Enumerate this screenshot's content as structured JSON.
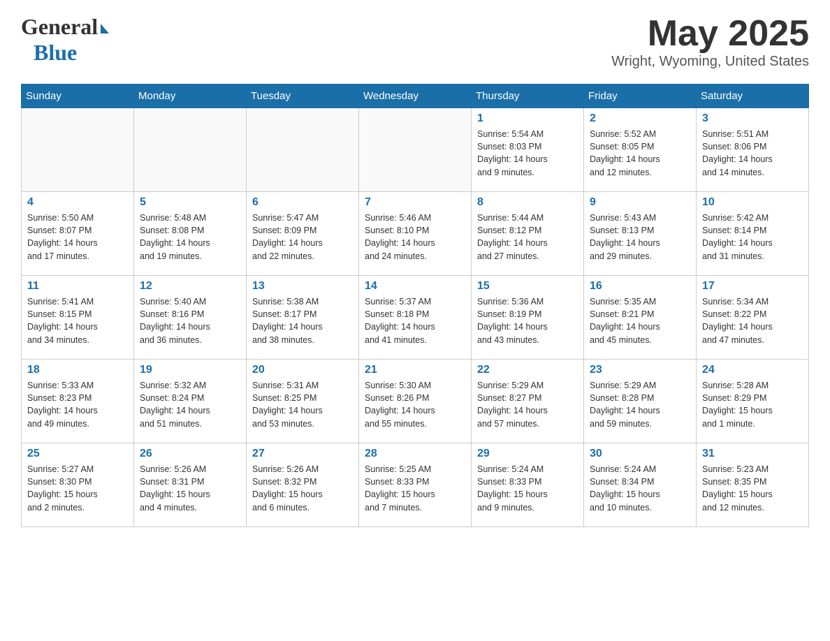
{
  "header": {
    "logo_general": "General",
    "logo_blue": "Blue",
    "month_year": "May 2025",
    "location": "Wright, Wyoming, United States"
  },
  "columns": [
    "Sunday",
    "Monday",
    "Tuesday",
    "Wednesday",
    "Thursday",
    "Friday",
    "Saturday"
  ],
  "weeks": [
    {
      "days": [
        {
          "date": "",
          "info": ""
        },
        {
          "date": "",
          "info": ""
        },
        {
          "date": "",
          "info": ""
        },
        {
          "date": "",
          "info": ""
        },
        {
          "date": "1",
          "info": "Sunrise: 5:54 AM\nSunset: 8:03 PM\nDaylight: 14 hours\nand 9 minutes."
        },
        {
          "date": "2",
          "info": "Sunrise: 5:52 AM\nSunset: 8:05 PM\nDaylight: 14 hours\nand 12 minutes."
        },
        {
          "date": "3",
          "info": "Sunrise: 5:51 AM\nSunset: 8:06 PM\nDaylight: 14 hours\nand 14 minutes."
        }
      ]
    },
    {
      "days": [
        {
          "date": "4",
          "info": "Sunrise: 5:50 AM\nSunset: 8:07 PM\nDaylight: 14 hours\nand 17 minutes."
        },
        {
          "date": "5",
          "info": "Sunrise: 5:48 AM\nSunset: 8:08 PM\nDaylight: 14 hours\nand 19 minutes."
        },
        {
          "date": "6",
          "info": "Sunrise: 5:47 AM\nSunset: 8:09 PM\nDaylight: 14 hours\nand 22 minutes."
        },
        {
          "date": "7",
          "info": "Sunrise: 5:46 AM\nSunset: 8:10 PM\nDaylight: 14 hours\nand 24 minutes."
        },
        {
          "date": "8",
          "info": "Sunrise: 5:44 AM\nSunset: 8:12 PM\nDaylight: 14 hours\nand 27 minutes."
        },
        {
          "date": "9",
          "info": "Sunrise: 5:43 AM\nSunset: 8:13 PM\nDaylight: 14 hours\nand 29 minutes."
        },
        {
          "date": "10",
          "info": "Sunrise: 5:42 AM\nSunset: 8:14 PM\nDaylight: 14 hours\nand 31 minutes."
        }
      ]
    },
    {
      "days": [
        {
          "date": "11",
          "info": "Sunrise: 5:41 AM\nSunset: 8:15 PM\nDaylight: 14 hours\nand 34 minutes."
        },
        {
          "date": "12",
          "info": "Sunrise: 5:40 AM\nSunset: 8:16 PM\nDaylight: 14 hours\nand 36 minutes."
        },
        {
          "date": "13",
          "info": "Sunrise: 5:38 AM\nSunset: 8:17 PM\nDaylight: 14 hours\nand 38 minutes."
        },
        {
          "date": "14",
          "info": "Sunrise: 5:37 AM\nSunset: 8:18 PM\nDaylight: 14 hours\nand 41 minutes."
        },
        {
          "date": "15",
          "info": "Sunrise: 5:36 AM\nSunset: 8:19 PM\nDaylight: 14 hours\nand 43 minutes."
        },
        {
          "date": "16",
          "info": "Sunrise: 5:35 AM\nSunset: 8:21 PM\nDaylight: 14 hours\nand 45 minutes."
        },
        {
          "date": "17",
          "info": "Sunrise: 5:34 AM\nSunset: 8:22 PM\nDaylight: 14 hours\nand 47 minutes."
        }
      ]
    },
    {
      "days": [
        {
          "date": "18",
          "info": "Sunrise: 5:33 AM\nSunset: 8:23 PM\nDaylight: 14 hours\nand 49 minutes."
        },
        {
          "date": "19",
          "info": "Sunrise: 5:32 AM\nSunset: 8:24 PM\nDaylight: 14 hours\nand 51 minutes."
        },
        {
          "date": "20",
          "info": "Sunrise: 5:31 AM\nSunset: 8:25 PM\nDaylight: 14 hours\nand 53 minutes."
        },
        {
          "date": "21",
          "info": "Sunrise: 5:30 AM\nSunset: 8:26 PM\nDaylight: 14 hours\nand 55 minutes."
        },
        {
          "date": "22",
          "info": "Sunrise: 5:29 AM\nSunset: 8:27 PM\nDaylight: 14 hours\nand 57 minutes."
        },
        {
          "date": "23",
          "info": "Sunrise: 5:29 AM\nSunset: 8:28 PM\nDaylight: 14 hours\nand 59 minutes."
        },
        {
          "date": "24",
          "info": "Sunrise: 5:28 AM\nSunset: 8:29 PM\nDaylight: 15 hours\nand 1 minute."
        }
      ]
    },
    {
      "days": [
        {
          "date": "25",
          "info": "Sunrise: 5:27 AM\nSunset: 8:30 PM\nDaylight: 15 hours\nand 2 minutes."
        },
        {
          "date": "26",
          "info": "Sunrise: 5:26 AM\nSunset: 8:31 PM\nDaylight: 15 hours\nand 4 minutes."
        },
        {
          "date": "27",
          "info": "Sunrise: 5:26 AM\nSunset: 8:32 PM\nDaylight: 15 hours\nand 6 minutes."
        },
        {
          "date": "28",
          "info": "Sunrise: 5:25 AM\nSunset: 8:33 PM\nDaylight: 15 hours\nand 7 minutes."
        },
        {
          "date": "29",
          "info": "Sunrise: 5:24 AM\nSunset: 8:33 PM\nDaylight: 15 hours\nand 9 minutes."
        },
        {
          "date": "30",
          "info": "Sunrise: 5:24 AM\nSunset: 8:34 PM\nDaylight: 15 hours\nand 10 minutes."
        },
        {
          "date": "31",
          "info": "Sunrise: 5:23 AM\nSunset: 8:35 PM\nDaylight: 15 hours\nand 12 minutes."
        }
      ]
    }
  ]
}
